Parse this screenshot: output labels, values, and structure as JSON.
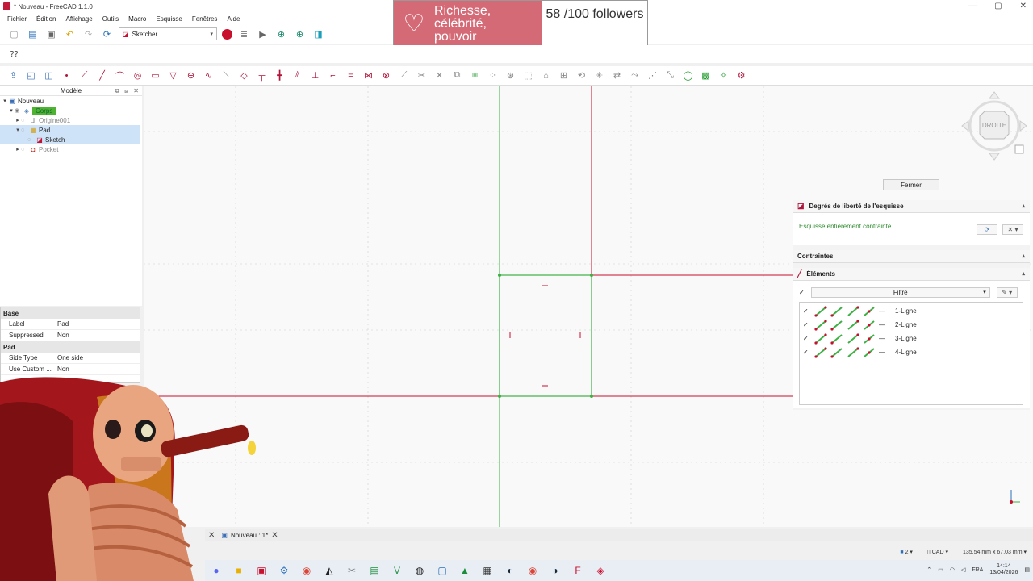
{
  "window": {
    "title": "* Nouveau - FreeCAD 1.1.0",
    "controls": [
      "—",
      "▢",
      "✕"
    ]
  },
  "menu": [
    "Fichier",
    "Édition",
    "Affichage",
    "Outils",
    "Macro",
    "Esquisse",
    "Fenêtres",
    "Aide"
  ],
  "toolbar": {
    "workbench": "Sketcher"
  },
  "overlay": {
    "line1": "Richesse,",
    "line2": "célébrité,",
    "line3": "pouvoir",
    "followers": "58 /100 followers"
  },
  "tree": {
    "header": "Modèle",
    "items": [
      {
        "label": "Nouveau"
      },
      {
        "label": "Corps"
      },
      {
        "label": "Origine001"
      },
      {
        "label": "Pad"
      },
      {
        "label": "Sketch"
      },
      {
        "label": "Pocket"
      }
    ]
  },
  "properties": {
    "groups": [
      {
        "name": "Base",
        "rows": [
          {
            "k": "Label",
            "v": "Pad"
          },
          {
            "k": "Suppressed",
            "v": "Non"
          }
        ]
      },
      {
        "name": "Pad",
        "rows": [
          {
            "k": "Side Type",
            "v": "One side"
          },
          {
            "k": "Use Custom ...",
            "v": "Non"
          }
        ]
      }
    ]
  },
  "navcube": {
    "face": "DROITE"
  },
  "fermer": "Fermer",
  "task": {
    "dof": {
      "title": "Degrés de liberté de l'esquisse",
      "status": "Esquisse entièrement contrainte"
    },
    "constraints": {
      "title": "Contraintes"
    },
    "elements": {
      "title": "Éléments",
      "filter": "Filtre",
      "items": [
        "1-Ligne",
        "2-Ligne",
        "3-Ligne",
        "4-Ligne"
      ]
    }
  },
  "tabs": {
    "doc": "Nouveau : 1*"
  },
  "status": {
    "layers": "2",
    "units": "CAD",
    "dims": "135,54 mm x 67,03 mm"
  },
  "tray": {
    "lang": "FRA",
    "time": "14:14",
    "date": "13/04/2026"
  },
  "colors": {
    "red_axis": "#c8102e",
    "green_axis": "#3cb043",
    "dof_ok": "#2e8b2e",
    "overlay_pink": "#d46a76"
  }
}
